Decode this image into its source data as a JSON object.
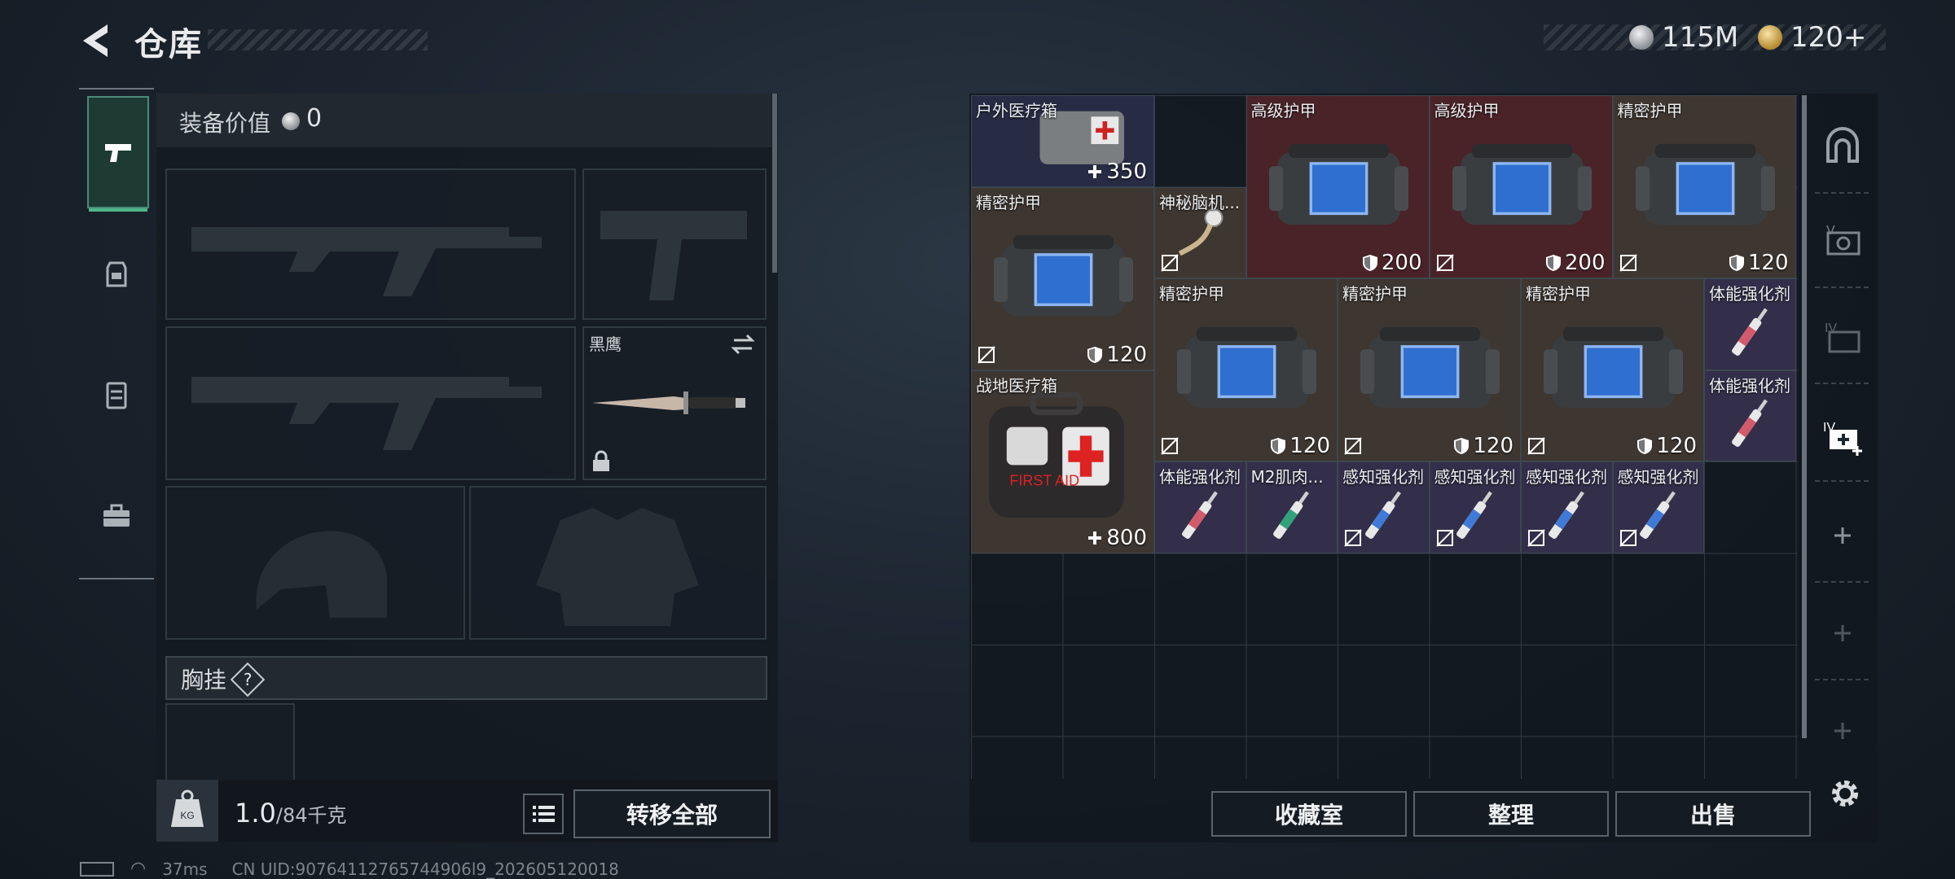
{
  "header": {
    "title": "仓库"
  },
  "currencies": [
    {
      "icon": "silver-coin-icon",
      "value": "115M"
    },
    {
      "icon": "gold-coin-icon",
      "value": "120+"
    }
  ],
  "left_tabs": [
    {
      "icon": "pistol-icon",
      "active": true
    },
    {
      "icon": "backpack-icon",
      "active": false
    },
    {
      "icon": "vest-icon",
      "active": false
    },
    {
      "icon": "toolbox-icon",
      "active": false
    }
  ],
  "equipment": {
    "value_label": "装备价值",
    "value": "0",
    "melee_slot_label": "黑鹰",
    "chest_label": "胸挂",
    "help": "?",
    "weight_current": "1.0",
    "weight_max": "/84千克",
    "transfer_all": "转移全部"
  },
  "status": {
    "ping": "37ms",
    "uid": "CN UID:90764112765744906l9_202605120018"
  },
  "items": [
    {
      "name": "户外医疗箱",
      "value": "350",
      "value_icon": "plus-icon"
    },
    {
      "name": "高级护甲",
      "value": "200",
      "value_icon": "shield-icon"
    },
    {
      "name": "高级护甲",
      "value": "200",
      "value_icon": "shield-icon"
    },
    {
      "name": "精密护甲",
      "value": "120",
      "value_icon": "shield-icon"
    },
    {
      "name": "精密护甲",
      "value": "120",
      "value_icon": "shield-icon"
    },
    {
      "name": "神秘脑机...",
      "value": "",
      "value_icon": ""
    },
    {
      "name": "精密护甲",
      "value": "120",
      "value_icon": "shield-icon"
    },
    {
      "name": "精密护甲",
      "value": "120",
      "value_icon": "shield-icon"
    },
    {
      "name": "精密护甲",
      "value": "120",
      "value_icon": "shield-icon"
    },
    {
      "name": "体能强化剂",
      "value": "",
      "value_icon": ""
    },
    {
      "name": "体能强化剂",
      "value": "",
      "value_icon": ""
    },
    {
      "name": "战地医疗箱",
      "value": "800",
      "value_icon": "plus-icon"
    },
    {
      "name": "体能强化剂",
      "value": "",
      "value_icon": ""
    },
    {
      "name": "M2肌肉...",
      "value": "",
      "value_icon": ""
    },
    {
      "name": "感知强化剂",
      "value": "",
      "value_icon": ""
    },
    {
      "name": "感知强化剂",
      "value": "",
      "value_icon": ""
    },
    {
      "name": "感知强化剂",
      "value": "",
      "value_icon": ""
    },
    {
      "name": "感知强化剂",
      "value": "",
      "value_icon": ""
    }
  ],
  "first_aid_text": "FIRST AID",
  "actions": {
    "collection": "收藏室",
    "organize": "整理",
    "sell": "出售"
  },
  "colors": {
    "accent": "#4fb58a",
    "rare_red": "#4a2328",
    "brown": "#3e3630",
    "blue": "#272b44"
  }
}
